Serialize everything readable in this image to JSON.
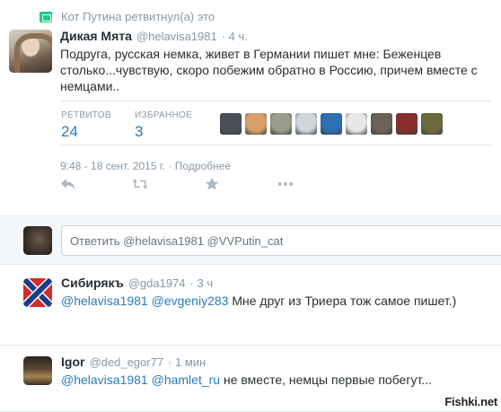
{
  "retweet_context": {
    "text": "Кот Путина ретвитнул(а) это",
    "icon": "retweet-icon",
    "icon_color": "#19cf86"
  },
  "main_tweet": {
    "name": "Дикая Мята",
    "handle": "@helavisa1981",
    "time": "· 4 ч.",
    "text": "Подруга, русская немка, живет в Германии пишет мне: Беженцев столько...чувствую, скоро побежим обратно в Россию, причем вместе с немцами..",
    "retweets_label": "РЕТВИТОВ",
    "retweets_count": "24",
    "favorites_label": "ИЗБРАННОЕ",
    "favorites_count": "3",
    "date": "9:48 - 18 сент. 2015 г.",
    "details_link": "· Подробнее",
    "favoriter_avatar_colors": [
      "#4a4f57",
      "#d8a068",
      "#9c9c8c",
      "#cfd7dd",
      "#2d6fb4",
      "#e7e7e7",
      "#6d6258",
      "#8c2d2d",
      "#6e6a3c"
    ]
  },
  "actions": {
    "reply": "reply-icon",
    "retweet": "retweet-icon",
    "favorite": "star-icon",
    "more": "more-icon"
  },
  "reply_box": {
    "value": "Ответить @helavisa1981 @VVPutin_cat"
  },
  "replies": [
    {
      "name": "Сибирякъ",
      "handle": "@gda1974",
      "time": "· 3 ч",
      "mentions": "@helavisa1981 @evgeniy283",
      "text": " Мне друг из Триера тож самое пишет.)"
    },
    {
      "name": "Igor",
      "handle": "@ded_egor77",
      "time": "· 1 мин",
      "mentions": "@helavisa1981 @hamlet_ru",
      "text": " не вместе, немцы первые побегут..."
    }
  ],
  "watermark": "Fishki.net",
  "colors": {
    "link": "#2b7bb9",
    "muted": "#8899a6",
    "text": "#292f33"
  }
}
